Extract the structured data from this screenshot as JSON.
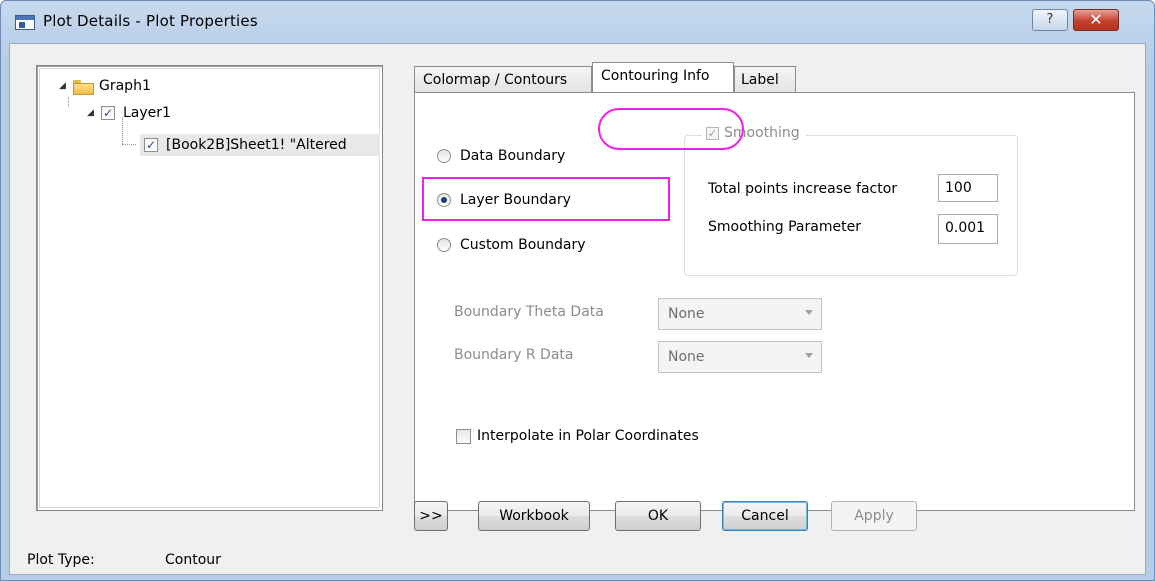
{
  "window": {
    "title": "Plot Details - Plot Properties",
    "help_label": "?",
    "close_label": "✕"
  },
  "tree": {
    "graph": "Graph1",
    "layer": "Layer1",
    "plot": "[Book2B]Sheet1! \"Altered"
  },
  "tabs": [
    {
      "label": "Colormap / Contours"
    },
    {
      "label": "Contouring Info"
    },
    {
      "label": "Label"
    }
  ],
  "boundary": {
    "data": "Data Boundary",
    "layer": "Layer Boundary",
    "custom": "Custom Boundary",
    "selected": "Layer Boundary"
  },
  "smoothing": {
    "label": "Smoothing",
    "checked": true,
    "total_points_label": "Total points increase factor",
    "total_points_value": "100",
    "parameter_label": "Smoothing Parameter",
    "parameter_value": "0.001"
  },
  "boundary_data": {
    "theta_label": "Boundary Theta Data",
    "theta_value": "None",
    "r_label": "Boundary R Data",
    "r_value": "None"
  },
  "interpolate_label": "Interpolate in Polar Coordinates",
  "footer": {
    "plot_type_label": "Plot Type:",
    "plot_type_value": "Contour",
    "expand_label": ">>",
    "workbook_label": "Workbook",
    "ok_label": "OK",
    "cancel_label": "Cancel",
    "apply_label": "Apply"
  },
  "colors": {
    "highlight": "#f01ee6"
  }
}
